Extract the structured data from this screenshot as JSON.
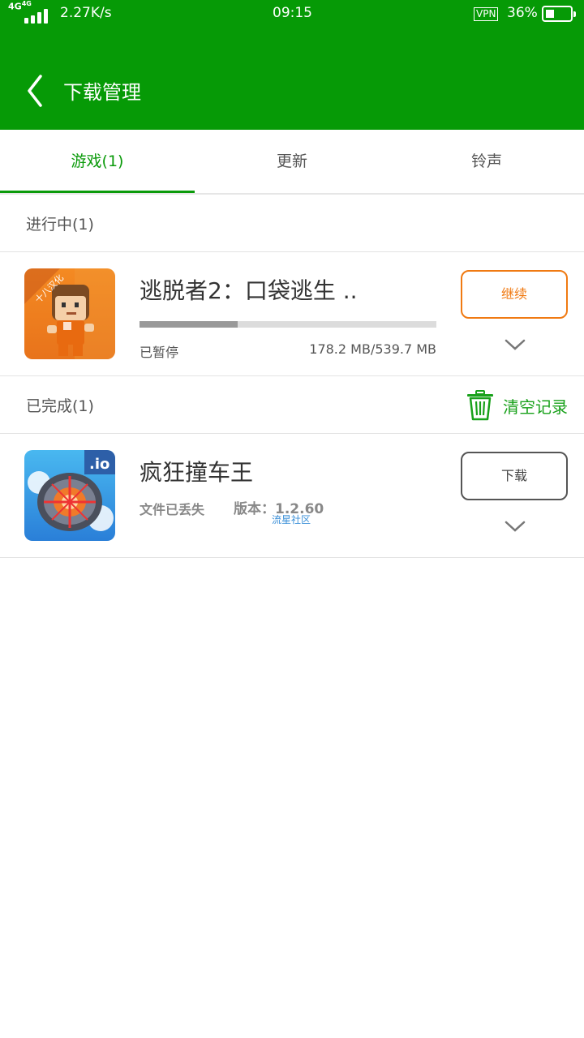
{
  "status_bar": {
    "network": "4G",
    "network2": "4G",
    "speed": "2.27K/s",
    "time": "09:15",
    "vpn": "VPN",
    "battery_pct": "36%",
    "battery_level": 0.36
  },
  "header": {
    "title": "下载管理"
  },
  "tabs": [
    {
      "label": "游戏(1)",
      "active": true
    },
    {
      "label": "更新",
      "active": false
    },
    {
      "label": "铃声",
      "active": false
    }
  ],
  "sections": {
    "in_progress": {
      "title": "进行中(1)",
      "items": [
        {
          "name": "逃脱者2：口袋逃生 ..",
          "progress": 0.33,
          "status": "已暂停",
          "size": "178.2 MB/539.7 MB",
          "button": "继续",
          "icon": "escapists-game-icon",
          "icon_badge": "十八汉化"
        }
      ]
    },
    "completed": {
      "title": "已完成(1)",
      "clear_label": "清空记录",
      "items": [
        {
          "name": "疯狂撞车王",
          "status": "文件已丢失",
          "version": "版本：1.2.60",
          "watermark": "流星社区",
          "button": "下载",
          "icon": "crash-wheel-game-icon",
          "icon_badge": ".io"
        }
      ]
    }
  },
  "colors": {
    "brand_green": "#069a06",
    "accent_orange": "#f07a12"
  }
}
